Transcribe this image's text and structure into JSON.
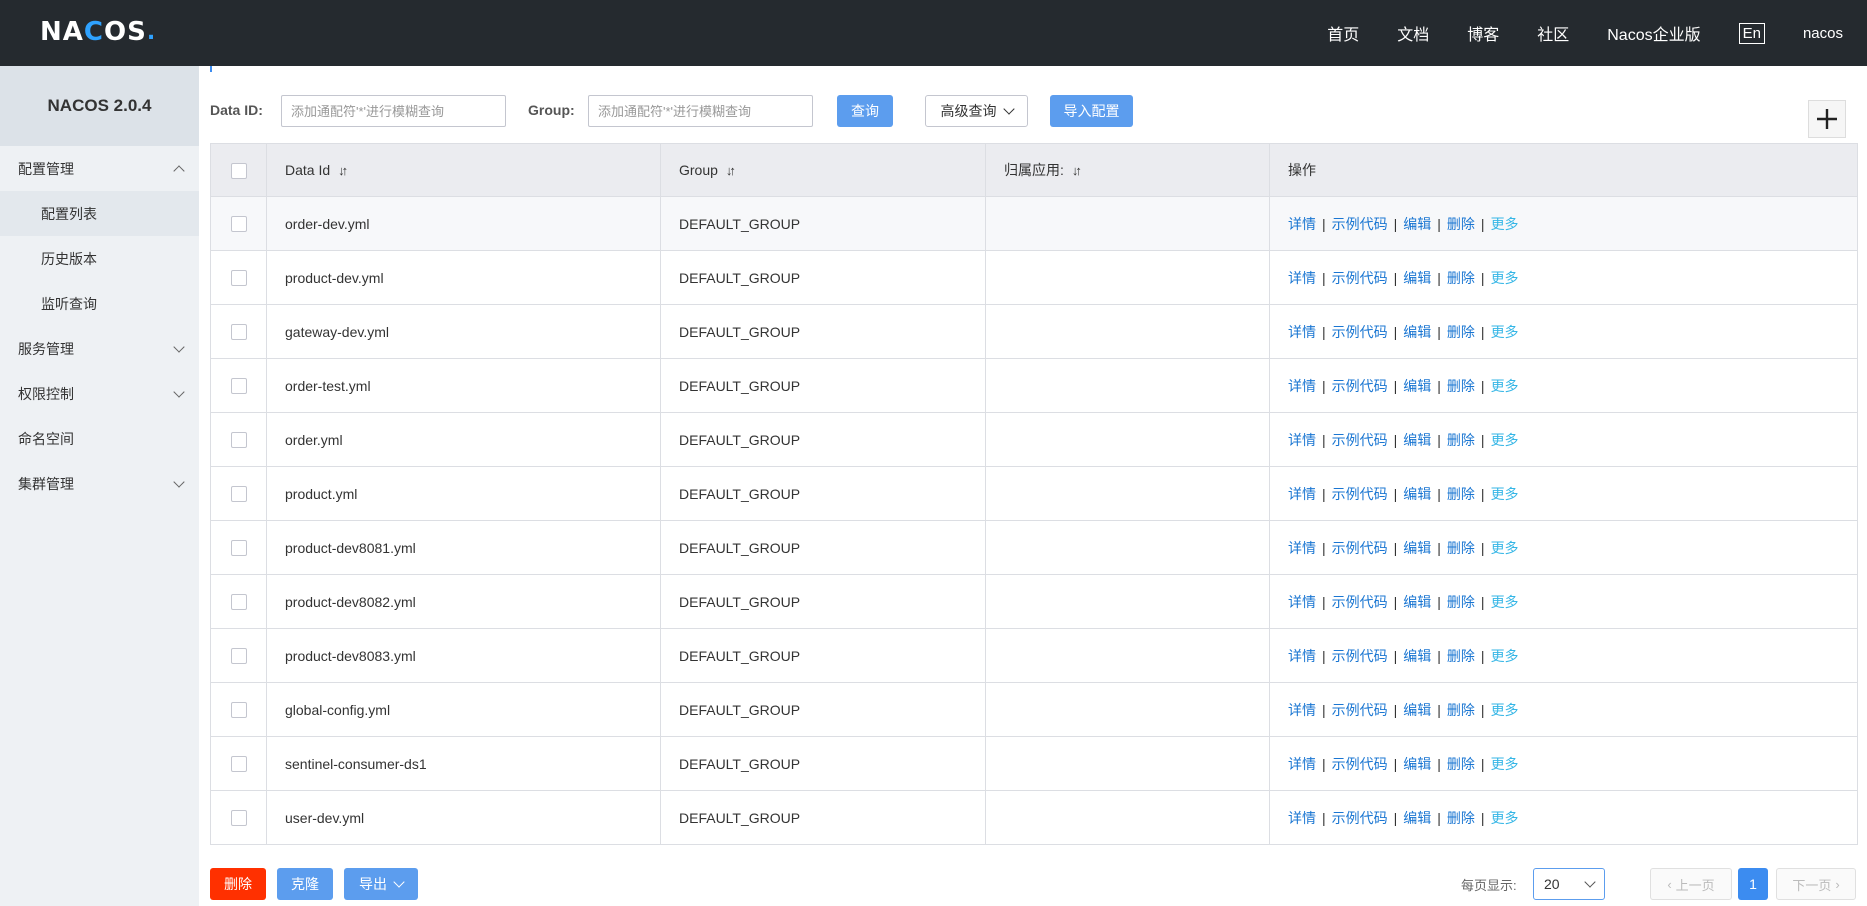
{
  "header": {
    "logo": {
      "a": "NA",
      "c": "C",
      "b": "OS",
      "dot": "."
    },
    "nav": [
      {
        "label": "首页"
      },
      {
        "label": "文档"
      },
      {
        "label": "博客"
      },
      {
        "label": "社区"
      },
      {
        "label": "Nacos企业版"
      }
    ],
    "lang": "En",
    "user": "nacos"
  },
  "sidebar": {
    "title": "NACOS 2.0.4",
    "config": {
      "label": "配置管理",
      "items": [
        {
          "label": "配置列表"
        },
        {
          "label": "历史版本"
        },
        {
          "label": "监听查询"
        }
      ]
    },
    "service": {
      "label": "服务管理"
    },
    "auth": {
      "label": "权限控制"
    },
    "namespace": {
      "label": "命名空间"
    },
    "cluster": {
      "label": "集群管理"
    }
  },
  "search": {
    "dataid_label": "Data ID:",
    "dataid_placeholder": "添加通配符'*'进行模糊查询",
    "group_label": "Group:",
    "group_placeholder": "添加通配符'*'进行模糊查询",
    "query_button": "查询",
    "advanced_button": "高级查询",
    "import_button": "导入配置"
  },
  "table": {
    "columns": {
      "dataid": "Data Id",
      "group": "Group",
      "app": "归属应用:",
      "ops": "操作"
    },
    "ops": {
      "detail": "详情",
      "sample": "示例代码",
      "edit": "编辑",
      "delete": "删除",
      "more": "更多",
      "sep": "|"
    },
    "rows": [
      {
        "dataid": "order-dev.yml",
        "group": "DEFAULT_GROUP",
        "app": ""
      },
      {
        "dataid": "product-dev.yml",
        "group": "DEFAULT_GROUP",
        "app": ""
      },
      {
        "dataid": "gateway-dev.yml",
        "group": "DEFAULT_GROUP",
        "app": ""
      },
      {
        "dataid": "order-test.yml",
        "group": "DEFAULT_GROUP",
        "app": ""
      },
      {
        "dataid": "order.yml",
        "group": "DEFAULT_GROUP",
        "app": ""
      },
      {
        "dataid": "product.yml",
        "group": "DEFAULT_GROUP",
        "app": ""
      },
      {
        "dataid": "product-dev8081.yml",
        "group": "DEFAULT_GROUP",
        "app": ""
      },
      {
        "dataid": "product-dev8082.yml",
        "group": "DEFAULT_GROUP",
        "app": ""
      },
      {
        "dataid": "product-dev8083.yml",
        "group": "DEFAULT_GROUP",
        "app": ""
      },
      {
        "dataid": "global-config.yml",
        "group": "DEFAULT_GROUP",
        "app": ""
      },
      {
        "dataid": "sentinel-consumer-ds1",
        "group": "DEFAULT_GROUP",
        "app": ""
      },
      {
        "dataid": "user-dev.yml",
        "group": "DEFAULT_GROUP",
        "app": ""
      }
    ]
  },
  "footer": {
    "delete_button": "删除",
    "clone_button": "克隆",
    "export_button": "导出",
    "pagesize_label": "每页显示:",
    "pagesize_value": "20",
    "prev": "上一页",
    "current_page": "1",
    "next": "下一页"
  },
  "colors": {
    "topbar": "#252a2f",
    "primary": "#5c9dee",
    "danger": "#ff3000",
    "link": "#1a76d2",
    "more_link": "#35b6e6"
  }
}
